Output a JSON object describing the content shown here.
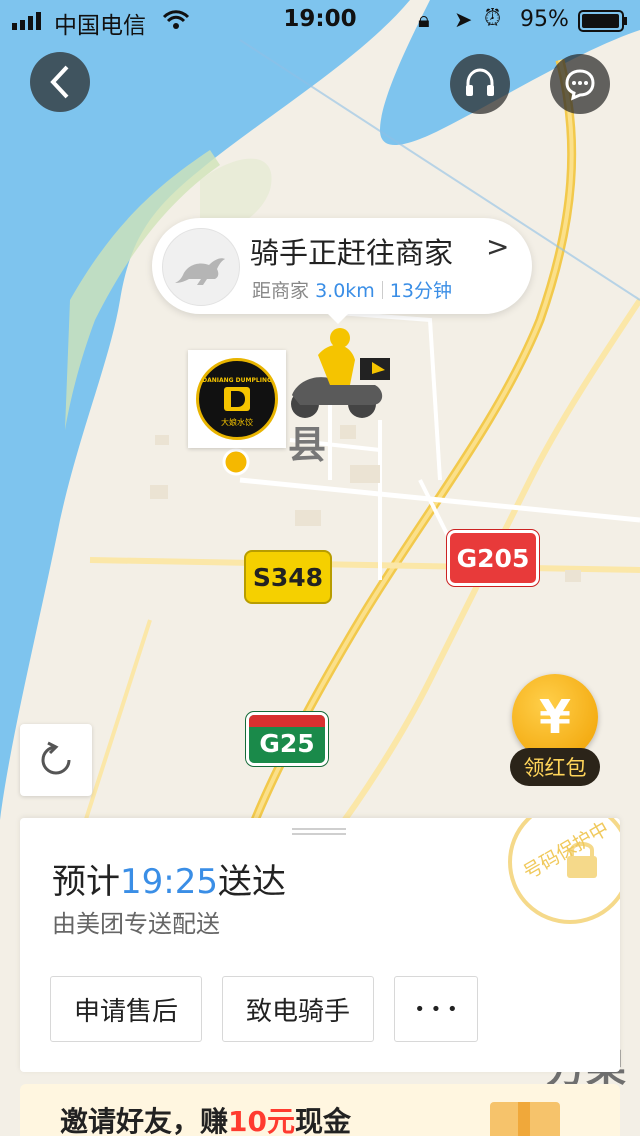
{
  "status_bar": {
    "carrier": "中国电信",
    "time": "19:00",
    "battery": "95%"
  },
  "top_bar": {
    "back_icon": "chevron-left-icon",
    "support_icon": "headset-icon",
    "message_icon": "chat-bubble-icon"
  },
  "map": {
    "county_label": "县",
    "roads": [
      "S348",
      "G205",
      "G25"
    ],
    "partial_label": "方果钅"
  },
  "rider": {
    "status": "骑手正赶往商家",
    "distance_prefix": "距商家",
    "distance": "3.0km",
    "duration": "13分钟"
  },
  "shop_marker": {
    "logo_text_top": "DANIANG DUMPLING",
    "logo_text_bottom": "大娘水饺"
  },
  "red_packet": {
    "coin_symbol": "¥",
    "label": "领红包"
  },
  "delivery": {
    "eta_prefix": "预计",
    "eta_time": "19:25",
    "eta_suffix": "送达",
    "carrier": "由美团专送配送",
    "privacy_stamp": "号码保护中",
    "buttons": {
      "after_sale": "申请售后",
      "call_rider": "致电骑手",
      "more": "• • •"
    }
  },
  "promo": {
    "text_prefix": "邀请好友，赚",
    "amount": "10元",
    "text_suffix": "现金"
  },
  "colors": {
    "water": "#7ec4ee",
    "land": "#f3efe6",
    "road": "#f2c94c",
    "accent_blue": "#3a8ee6",
    "accent_red": "#ff3b2f"
  }
}
